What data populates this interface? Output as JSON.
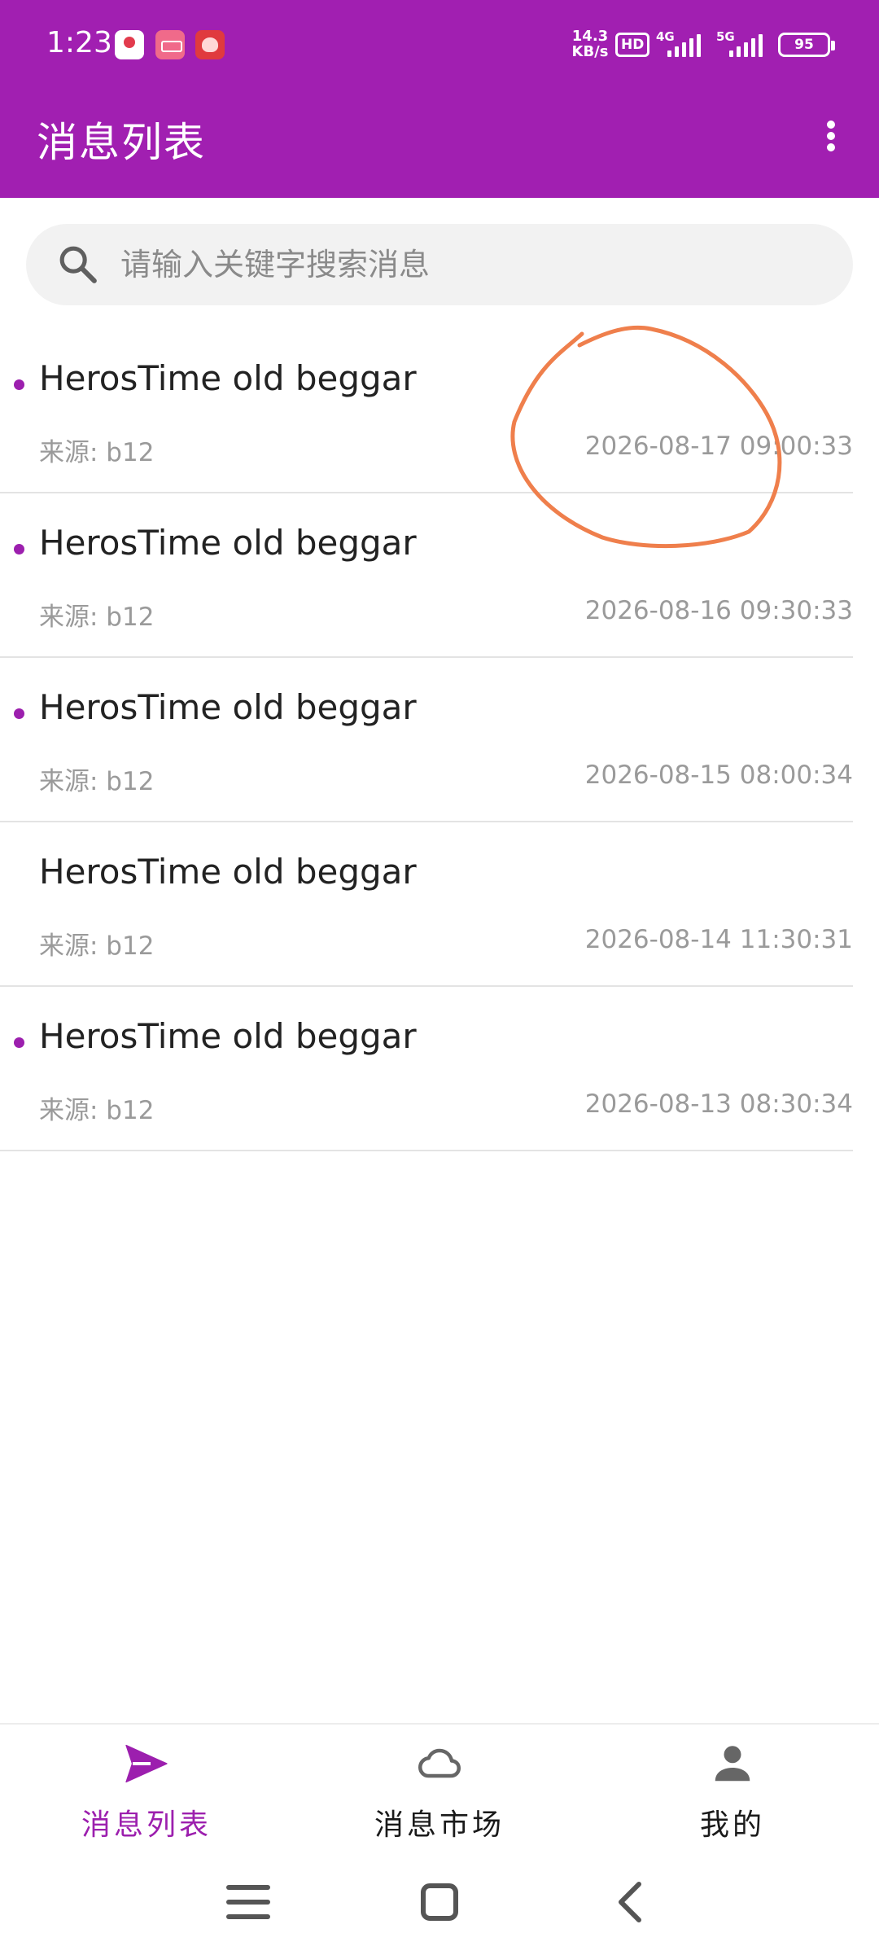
{
  "status_bar": {
    "time": "1:23",
    "net_speed_value": "14.3",
    "net_speed_unit": "KB/s",
    "hd_label": "HD",
    "net_4g": "4G",
    "net_5g": "5G",
    "battery": "95"
  },
  "app_bar": {
    "title": "消息列表",
    "more_icon": "more-vert-icon"
  },
  "search": {
    "placeholder": "请输入关键字搜索消息",
    "value": "",
    "icon": "search-icon"
  },
  "messages": [
    {
      "title": "HerosTime old beggar",
      "source": "来源: b12",
      "time": "2026-08-17 09:00:33",
      "unread": true
    },
    {
      "title": "HerosTime old beggar",
      "source": "来源: b12",
      "time": "2026-08-16 09:30:33",
      "unread": true
    },
    {
      "title": "HerosTime old beggar",
      "source": "来源: b12",
      "time": "2026-08-15 08:00:34",
      "unread": true
    },
    {
      "title": "HerosTime old beggar",
      "source": "来源: b12",
      "time": "2026-08-14 11:30:31",
      "unread": false
    },
    {
      "title": "HerosTime old beggar",
      "source": "来源: b12",
      "time": "2026-08-13 08:30:34",
      "unread": true
    }
  ],
  "bottom_nav": {
    "items": [
      {
        "label": "消息列表",
        "icon": "send-icon",
        "active": true
      },
      {
        "label": "消息市场",
        "icon": "cloud-icon",
        "active": false
      },
      {
        "label": "我的",
        "icon": "person-icon",
        "active": false
      }
    ]
  },
  "colors": {
    "primary": "#a11fb1",
    "accent": "#9c1fae",
    "annotation": "#ef7f4c",
    "muted_text": "#9a9a9a"
  }
}
